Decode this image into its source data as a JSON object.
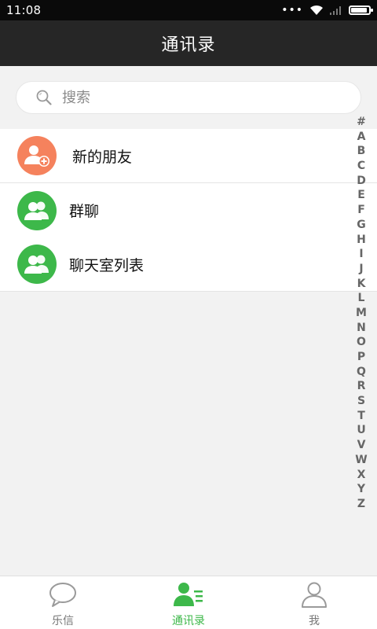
{
  "status_bar": {
    "time": "11:08",
    "dots": "•••"
  },
  "header": {
    "title": "通讯录"
  },
  "search": {
    "placeholder": "搜索"
  },
  "list": {
    "items": [
      {
        "label": "新的朋友",
        "icon": "add-user-icon",
        "color": "#f5825d"
      },
      {
        "label": "群聊",
        "icon": "group-icon",
        "color": "#3db84a"
      },
      {
        "label": "聊天室列表",
        "icon": "group-icon",
        "color": "#3db84a"
      }
    ]
  },
  "alpha_index": [
    "#",
    "A",
    "B",
    "C",
    "D",
    "E",
    "F",
    "G",
    "H",
    "I",
    "J",
    "K",
    "L",
    "M",
    "N",
    "O",
    "P",
    "Q",
    "R",
    "S",
    "T",
    "U",
    "V",
    "W",
    "X",
    "Y",
    "Z"
  ],
  "bottom_nav": {
    "tabs": [
      {
        "label": "乐信",
        "icon": "chat-bubble-icon",
        "active": false
      },
      {
        "label": "通讯录",
        "icon": "contacts-icon",
        "active": true
      },
      {
        "label": "我",
        "icon": "person-icon",
        "active": false
      }
    ]
  },
  "colors": {
    "accent": "#3db84a",
    "orange": "#f5825d",
    "header_bg": "#262626"
  }
}
